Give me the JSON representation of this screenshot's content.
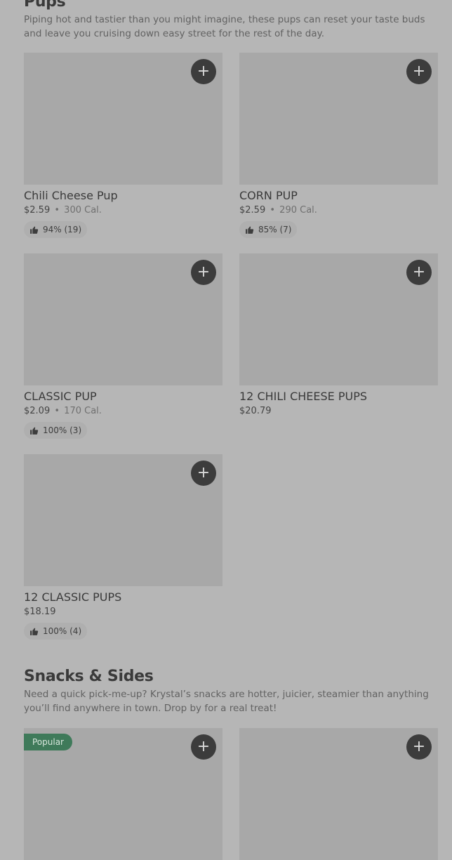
{
  "pups": {
    "title": "Pups",
    "description": "Piping hot and tastier than you might imagine, these pups can reset your taste buds and leave you cruising down easy street for the rest of the day.",
    "items": [
      {
        "name": "Chili Cheese Pup",
        "price": "$2.59",
        "sep": "•",
        "calories": "300 Cal.",
        "rating": "94% (19)"
      },
      {
        "name": "CORN PUP",
        "price": "$2.59",
        "sep": "•",
        "calories": "290 Cal.",
        "rating": "85% (7)"
      },
      {
        "name": "CLASSIC PUP",
        "price": "$2.09",
        "sep": "•",
        "calories": "170 Cal.",
        "rating": "100% (3)"
      },
      {
        "name": "12 CHILI CHEESE PUPS",
        "price": "$20.79"
      },
      {
        "name": "12 CLASSIC PUPS",
        "price": "$18.19",
        "rating": "100% (4)"
      }
    ]
  },
  "snacks": {
    "title": "Snacks & Sides",
    "description": "Need a quick pick-me-up? Krystal’s snacks are hotter, juicier, steamier than anything you’ll find anywhere in town. Drop by for a real treat!",
    "items": [
      {
        "badge": "Popular"
      },
      {}
    ]
  },
  "icons": {
    "add": "plus-icon",
    "rating": "thumbs-up-icon"
  },
  "add_symbol": "+"
}
